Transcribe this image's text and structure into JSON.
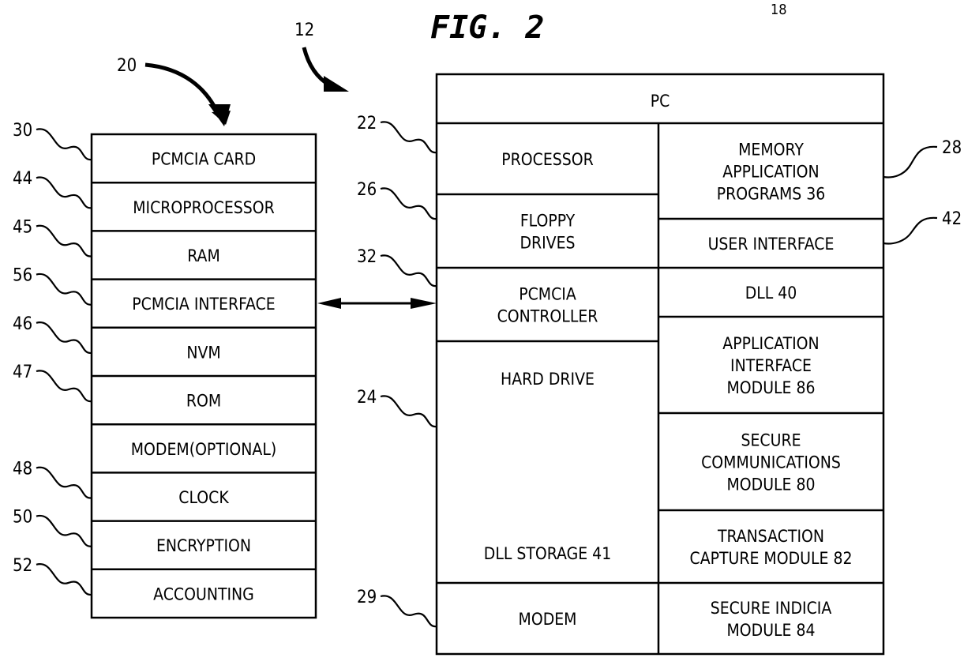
{
  "figure": {
    "title": "FIG. 2",
    "corner_ref": "18"
  },
  "card": {
    "ref": "20",
    "rows": [
      {
        "label": "PCMCIA CARD",
        "ref": "30"
      },
      {
        "label": "MICROPROCESSOR",
        "ref": "44"
      },
      {
        "label": "RAM",
        "ref": "45"
      },
      {
        "label": "PCMCIA INTERFACE",
        "ref": "56"
      },
      {
        "label": "NVM",
        "ref": "46"
      },
      {
        "label": "ROM",
        "ref": "47"
      },
      {
        "label": "MODEM(OPTIONAL)",
        "ref": ""
      },
      {
        "label": "CLOCK",
        "ref": "48"
      },
      {
        "label": "ENCRYPTION",
        "ref": "50"
      },
      {
        "label": "ACCOUNTING",
        "ref": "52"
      }
    ]
  },
  "pc": {
    "ref": "12",
    "header": "PC",
    "left_column": [
      {
        "lines": [
          "PROCESSOR"
        ],
        "ref": "22"
      },
      {
        "lines": [
          "FLOPPY",
          "DRIVES"
        ],
        "ref": "26"
      },
      {
        "lines": [
          "PCMCIA",
          "CONTROLLER"
        ],
        "ref": "32"
      },
      {
        "lines": [
          "HARD DRIVE"
        ],
        "sub": "DLL STORAGE 41",
        "ref": "24"
      },
      {
        "lines": [
          "MODEM"
        ],
        "ref": "29"
      }
    ],
    "right_column": [
      {
        "lines": [
          "MEMORY",
          "APPLICATION",
          "PROGRAMS 36"
        ],
        "ref": "28"
      },
      {
        "lines": [
          "USER INTERFACE"
        ],
        "ref": "42"
      },
      {
        "lines": [
          "DLL 40"
        ],
        "ref": ""
      },
      {
        "lines": [
          "APPLICATION",
          "INTERFACE",
          "MODULE 86"
        ],
        "ref": ""
      },
      {
        "lines": [
          "SECURE",
          "COMMUNICATIONS",
          "MODULE 80"
        ],
        "ref": ""
      },
      {
        "lines": [
          "TRANSACTION",
          "CAPTURE MODULE 82"
        ],
        "ref": ""
      },
      {
        "lines": [
          "SECURE INDICIA",
          "MODULE 84"
        ],
        "ref": ""
      }
    ]
  },
  "connection": {
    "from": "PCMCIA INTERFACE",
    "to": "PCMCIA CONTROLLER",
    "type": "bidirectional"
  }
}
